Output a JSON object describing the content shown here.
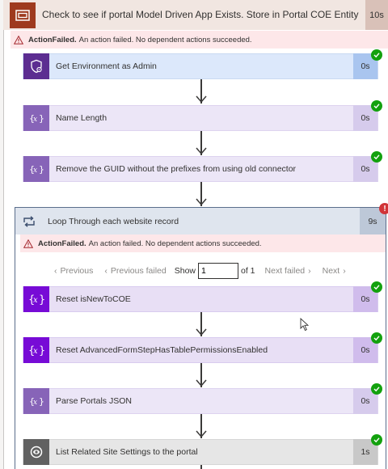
{
  "outer_scope": {
    "title": "Check to see if portal Model Driven App Exists. Store in Portal COE Entity",
    "duration": "10s"
  },
  "outer_error": {
    "label": "ActionFailed.",
    "message": "An action failed. No dependent actions succeeded."
  },
  "actions": [
    {
      "label": "Get Environment as Admin",
      "duration": "0s",
      "icon": "shield-gear-icon"
    },
    {
      "label": "Name Length",
      "duration": "0s",
      "icon": "expression-icon"
    },
    {
      "label": "Remove the GUID without the prefixes from using old connector",
      "duration": "0s",
      "icon": "expression-icon"
    }
  ],
  "loop": {
    "title": "Loop Through each website record",
    "duration": "9s",
    "error": {
      "label": "ActionFailed.",
      "message": "An action failed. No dependent actions succeeded."
    },
    "pager": {
      "previous": "Previous",
      "previous_failed": "Previous failed",
      "show": "Show",
      "page_value": "1",
      "of_total": "of 1",
      "next_failed": "Next failed",
      "next": "Next"
    },
    "actions": [
      {
        "label": "Reset isNewToCOE",
        "duration": "0s",
        "icon": "variable-icon"
      },
      {
        "label": "Reset AdvancedFormStepHasTablePermissionsEnabled",
        "duration": "0s",
        "icon": "variable-icon"
      },
      {
        "label": "Parse Portals JSON",
        "duration": "0s",
        "icon": "expression-icon"
      },
      {
        "label": "List Related Site Settings to the portal",
        "duration": "1s",
        "icon": "dataverse-icon"
      }
    ]
  },
  "colors": {
    "outer_header": "#f1e6e1",
    "outer_icon": "#9e3a1e",
    "error_bg": "#fde7e9",
    "shield_card": "#dce8fb",
    "shield_icon": "#5c2d91",
    "expression_card": "#ece6f7",
    "expression_icon": "#8764b8",
    "variable_card": "#e8dff5",
    "variable_icon": "#770bd6",
    "loop_header": "#dfe5ee",
    "dataverse_card": "#e6e6e6",
    "dataverse_icon": "#616161",
    "success": "#13a10e",
    "fail": "#d13438"
  }
}
